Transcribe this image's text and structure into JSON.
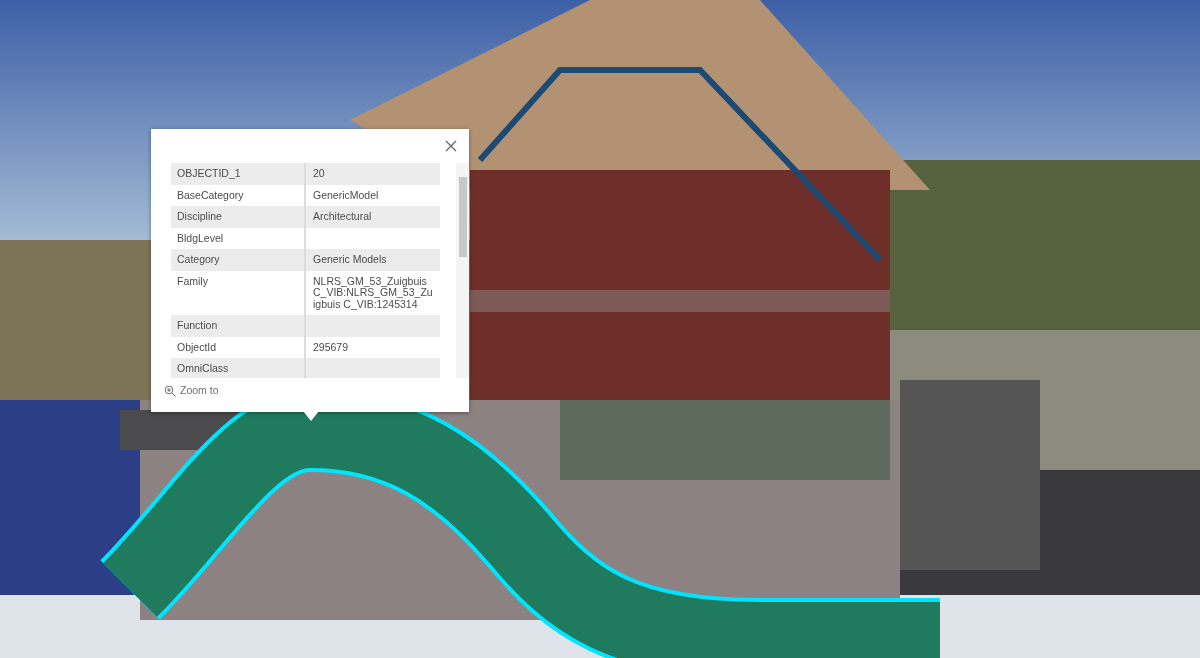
{
  "popup": {
    "rows": [
      {
        "field": "OBJECTID_1",
        "value": "20"
      },
      {
        "field": "BaseCategory",
        "value": "GenericModel"
      },
      {
        "field": "Discipline",
        "value": "Architectural"
      },
      {
        "field": "BldgLevel"
      },
      {
        "field": "Category",
        "value": "Generic Models"
      },
      {
        "field": "Family",
        "value": "NLRS_GM_53_Zuigbuis C_VIB:NLRS_GM_53_Zuigbuis C_VIB:1245314"
      },
      {
        "field": "Function"
      },
      {
        "field": "ObjectId",
        "value": "295679"
      },
      {
        "field": "OmniClass"
      }
    ],
    "action": "Zoom to"
  }
}
